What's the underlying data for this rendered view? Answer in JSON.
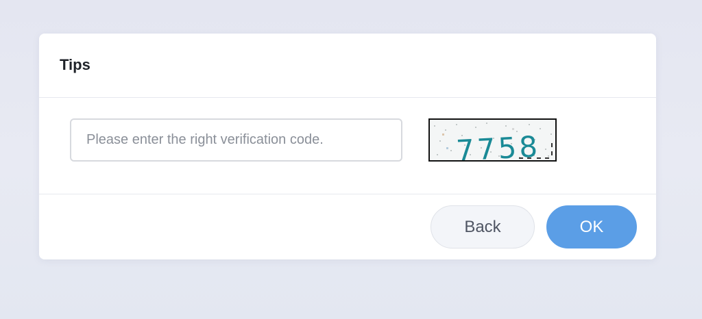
{
  "dialog": {
    "title": "Tips",
    "input": {
      "placeholder": "Please enter the right verification code.",
      "value": ""
    },
    "captcha": {
      "text": "7758",
      "text_color": "#1a8a96"
    },
    "buttons": {
      "back_label": "Back",
      "ok_label": "OK"
    }
  },
  "colors": {
    "background": "#e6e8f2",
    "primary": "#5b9ee6",
    "secondary_button": "#f3f5f9"
  }
}
